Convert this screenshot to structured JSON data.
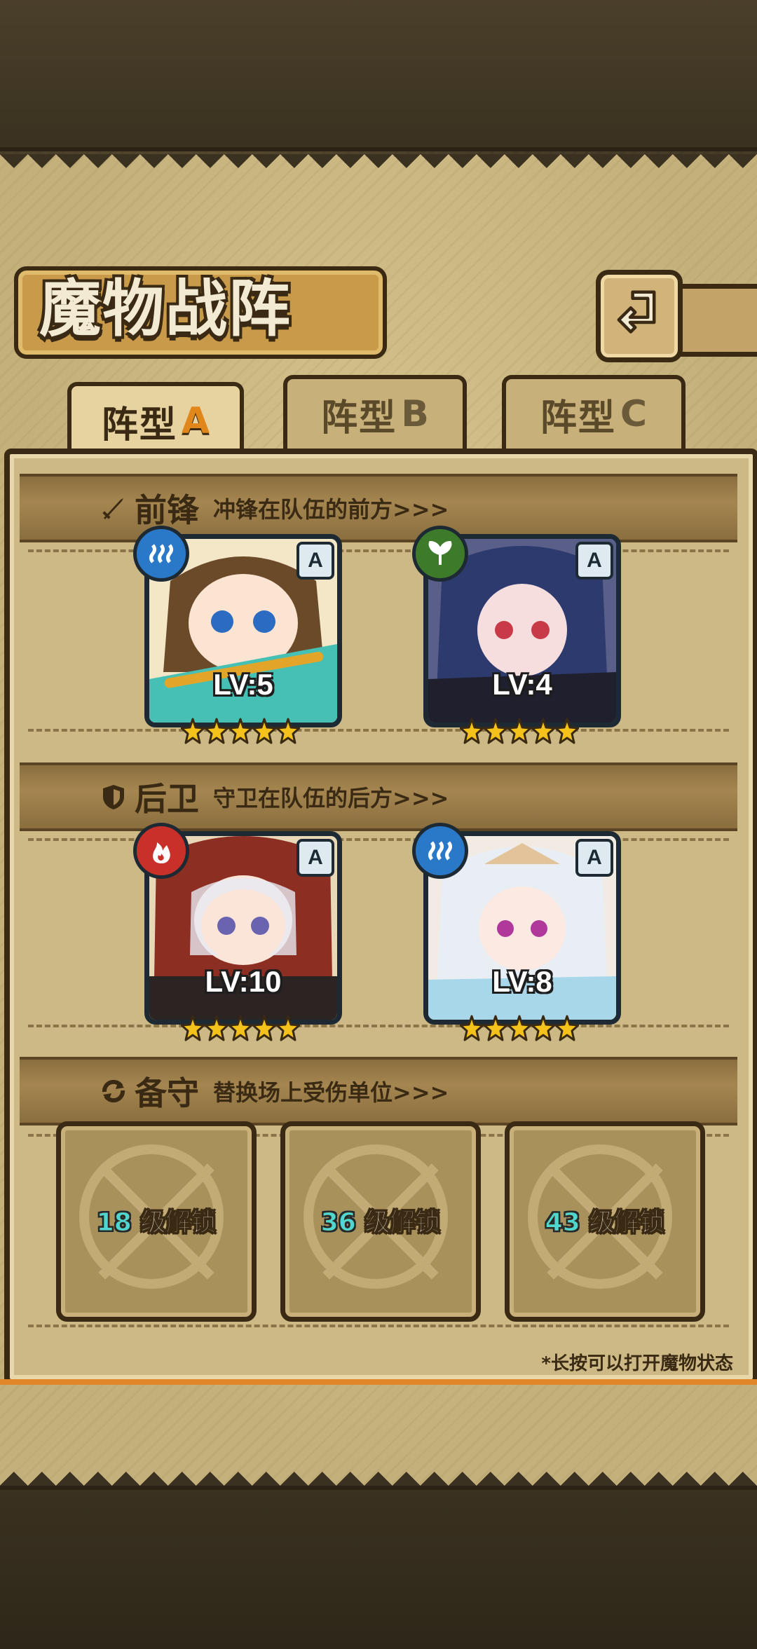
{
  "screen": {
    "title": "魔物战阵",
    "back_icon": "return-arrow-icon"
  },
  "tabs": [
    {
      "label": "阵型",
      "suffix": "A",
      "active": true
    },
    {
      "label": "阵型",
      "suffix": "B",
      "active": false
    },
    {
      "label": "阵型",
      "suffix": "C",
      "active": false
    }
  ],
  "sections": {
    "vanguard": {
      "icon": "sword-icon",
      "title": "前锋",
      "desc": "冲锋在队伍的前方>>>"
    },
    "rearguard": {
      "icon": "shield-icon",
      "title": "后卫",
      "desc": "守卫在队伍的后方>>>"
    },
    "reserve": {
      "icon": "swap-icon",
      "title": "备守",
      "desc": "替换场上受伤单位>>>"
    }
  },
  "monsters": [
    {
      "row": "vanguard",
      "level": "LV:5",
      "rank": "A",
      "element": "water",
      "element_color": "#2a79c9",
      "stars": 5
    },
    {
      "row": "vanguard",
      "level": "LV:4",
      "rank": "A",
      "element": "leaf",
      "element_color": "#3d7a2a",
      "stars": 5
    },
    {
      "row": "rearguard",
      "level": "LV:10",
      "rank": "A",
      "element": "fire",
      "element_color": "#c9302a",
      "stars": 5
    },
    {
      "row": "rearguard",
      "level": "LV:8",
      "rank": "A",
      "element": "water",
      "element_color": "#2a79c9",
      "stars": 5
    }
  ],
  "reserve_slots": [
    {
      "level": "18",
      "text": "级解锁"
    },
    {
      "level": "36",
      "text": "级解锁"
    },
    {
      "level": "43",
      "text": "级解锁"
    }
  ],
  "hint": "*长按可以打开魔物状态",
  "colors": {
    "accent_orange": "#e0861a",
    "card_border": "#8fd3e0",
    "star": "#f5c21b"
  }
}
